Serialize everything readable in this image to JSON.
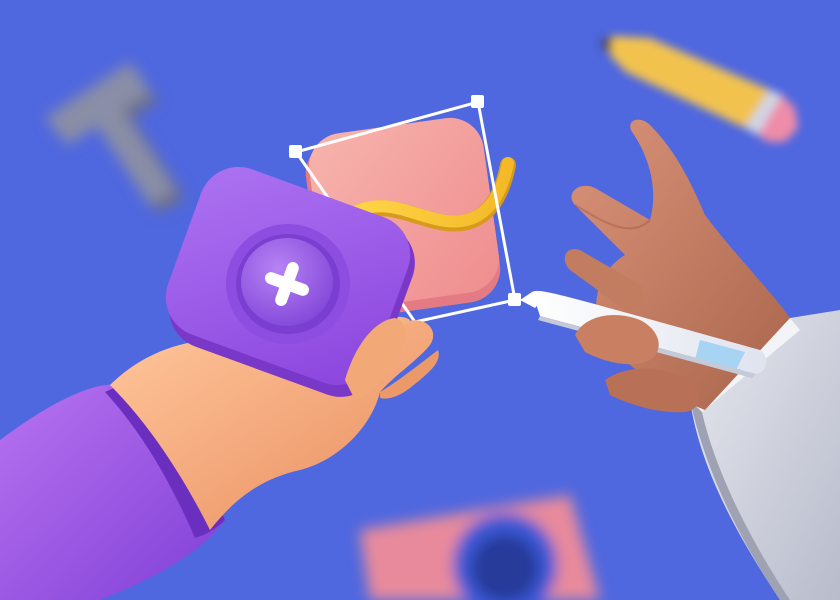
{
  "scene": {
    "background_color": "#4f67df",
    "objects": [
      {
        "name": "blurred-text-tool-icon",
        "color": "#8a8ea6"
      },
      {
        "name": "blurred-pencil-icon",
        "color": "#f2c250"
      },
      {
        "name": "blurred-camera-icon",
        "color": "#e88a9c"
      },
      {
        "name": "pink-card-with-yellow-curve",
        "color": "#f4a6a6"
      },
      {
        "name": "selection-frame",
        "color": "#ffffff"
      },
      {
        "name": "purple-close-button-tile",
        "color": "#9a5be6"
      },
      {
        "name": "left-hand-with-purple-sleeve",
        "color": "#f3a977"
      },
      {
        "name": "right-hand-with-stylus-gray-sleeve",
        "color": "#c98062"
      }
    ]
  }
}
